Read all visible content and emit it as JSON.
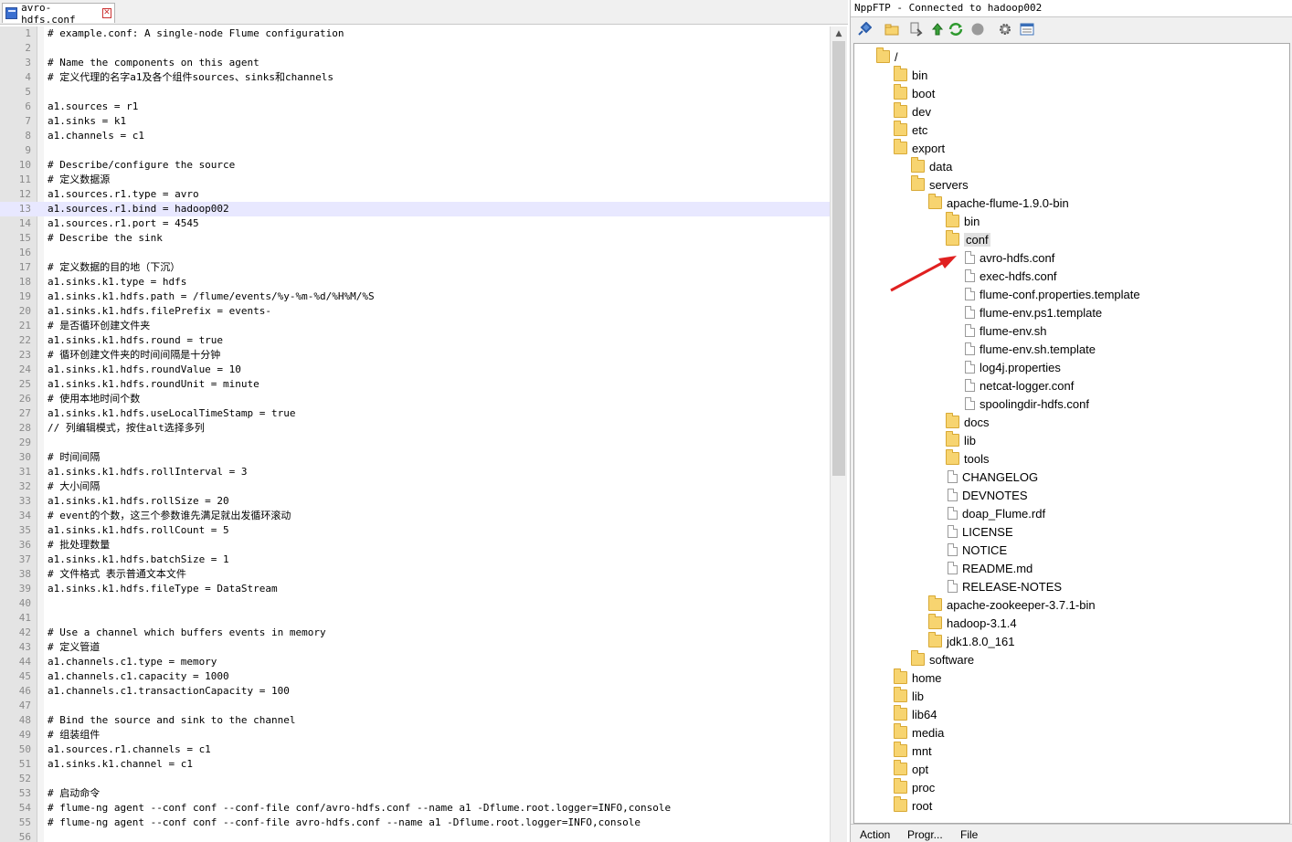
{
  "editor": {
    "tab_label": "avro-hdfs.conf",
    "current_line": 13,
    "lines": [
      "# example.conf: A single-node Flume configuration",
      "",
      "# Name the components on this agent",
      "# 定义代理的名字a1及各个组件sources、sinks和channels",
      "",
      "a1.sources = r1",
      "a1.sinks = k1",
      "a1.channels = c1",
      "",
      "# Describe/configure the source",
      "# 定义数据源",
      "a1.sources.r1.type = avro",
      "a1.sources.r1.bind = hadoop002",
      "a1.sources.r1.port = 4545",
      "# Describe the sink",
      "",
      "# 定义数据的目的地（下沉）",
      "a1.sinks.k1.type = hdfs",
      "a1.sinks.k1.hdfs.path = /flume/events/%y-%m-%d/%H%M/%S",
      "a1.sinks.k1.hdfs.filePrefix = events-",
      "# 是否循环创建文件夹",
      "a1.sinks.k1.hdfs.round = true",
      "# 循环创建文件夹的时间间隔是十分钟",
      "a1.sinks.k1.hdfs.roundValue = 10",
      "a1.sinks.k1.hdfs.roundUnit = minute",
      "# 使用本地时间个数",
      "a1.sinks.k1.hdfs.useLocalTimeStamp = true",
      "// 列编辑模式，按住alt选择多列",
      "",
      "# 时间间隔",
      "a1.sinks.k1.hdfs.rollInterval = 3",
      "# 大小间隔",
      "a1.sinks.k1.hdfs.rollSize = 20",
      "# event的个数，这三个参数谁先满足就出发循环滚动",
      "a1.sinks.k1.hdfs.rollCount = 5",
      "# 批处理数量",
      "a1.sinks.k1.hdfs.batchSize = 1",
      "# 文件格式 表示普通文本文件",
      "a1.sinks.k1.hdfs.fileType = DataStream",
      "",
      "",
      "# Use a channel which buffers events in memory",
      "# 定义管道",
      "a1.channels.c1.type = memory",
      "a1.channels.c1.capacity = 1000",
      "a1.channels.c1.transactionCapacity = 100",
      "",
      "# Bind the source and sink to the channel",
      "# 组装组件",
      "a1.sources.r1.channels = c1",
      "a1.sinks.k1.channel = c1",
      "",
      "# 启动命令",
      "# flume-ng agent --conf conf --conf-file conf/avro-hdfs.conf --name a1 -Dflume.root.logger=INFO,console",
      "# flume-ng agent --conf conf --conf-file avro-hdfs.conf --name a1 -Dflume.root.logger=INFO,console",
      ""
    ]
  },
  "ftp": {
    "title": "NppFTP - Connected to hadoop002",
    "toolbar_icons": [
      "connect-icon",
      "open-folder-icon",
      "download-icon",
      "upload-icon",
      "refresh-icon",
      "stop-icon",
      "settings-icon",
      "message-window-icon"
    ],
    "tree": [
      {
        "label": "/",
        "type": "folder",
        "depth": 0
      },
      {
        "label": "bin",
        "type": "folder",
        "depth": 1
      },
      {
        "label": "boot",
        "type": "folder",
        "depth": 1
      },
      {
        "label": "dev",
        "type": "folder",
        "depth": 1
      },
      {
        "label": "etc",
        "type": "folder",
        "depth": 1
      },
      {
        "label": "export",
        "type": "folder",
        "depth": 1
      },
      {
        "label": "data",
        "type": "folder",
        "depth": 2
      },
      {
        "label": "servers",
        "type": "folder",
        "depth": 2
      },
      {
        "label": "apache-flume-1.9.0-bin",
        "type": "folder",
        "depth": 3
      },
      {
        "label": "bin",
        "type": "folder",
        "depth": 4
      },
      {
        "label": "conf",
        "type": "folder",
        "depth": 4,
        "selected": true
      },
      {
        "label": "avro-hdfs.conf",
        "type": "file",
        "depth": 5
      },
      {
        "label": "exec-hdfs.conf",
        "type": "file",
        "depth": 5
      },
      {
        "label": "flume-conf.properties.template",
        "type": "file",
        "depth": 5
      },
      {
        "label": "flume-env.ps1.template",
        "type": "file",
        "depth": 5
      },
      {
        "label": "flume-env.sh",
        "type": "file",
        "depth": 5
      },
      {
        "label": "flume-env.sh.template",
        "type": "file",
        "depth": 5
      },
      {
        "label": "log4j.properties",
        "type": "file",
        "depth": 5
      },
      {
        "label": "netcat-logger.conf",
        "type": "file",
        "depth": 5
      },
      {
        "label": "spoolingdir-hdfs.conf",
        "type": "file",
        "depth": 5
      },
      {
        "label": "docs",
        "type": "folder",
        "depth": 4
      },
      {
        "label": "lib",
        "type": "folder",
        "depth": 4
      },
      {
        "label": "tools",
        "type": "folder",
        "depth": 4
      },
      {
        "label": "CHANGELOG",
        "type": "file",
        "depth": 4
      },
      {
        "label": "DEVNOTES",
        "type": "file",
        "depth": 4
      },
      {
        "label": "doap_Flume.rdf",
        "type": "file",
        "depth": 4
      },
      {
        "label": "LICENSE",
        "type": "file",
        "depth": 4
      },
      {
        "label": "NOTICE",
        "type": "file",
        "depth": 4
      },
      {
        "label": "README.md",
        "type": "file",
        "depth": 4
      },
      {
        "label": "RELEASE-NOTES",
        "type": "file",
        "depth": 4
      },
      {
        "label": "apache-zookeeper-3.7.1-bin",
        "type": "folder",
        "depth": 3
      },
      {
        "label": "hadoop-3.1.4",
        "type": "folder",
        "depth": 3
      },
      {
        "label": "jdk1.8.0_161",
        "type": "folder",
        "depth": 3
      },
      {
        "label": "software",
        "type": "folder",
        "depth": 2
      },
      {
        "label": "home",
        "type": "folder",
        "depth": 1
      },
      {
        "label": "lib",
        "type": "folder",
        "depth": 1
      },
      {
        "label": "lib64",
        "type": "folder",
        "depth": 1
      },
      {
        "label": "media",
        "type": "folder",
        "depth": 1
      },
      {
        "label": "mnt",
        "type": "folder",
        "depth": 1
      },
      {
        "label": "opt",
        "type": "folder",
        "depth": 1
      },
      {
        "label": "proc",
        "type": "folder",
        "depth": 1
      },
      {
        "label": "root",
        "type": "folder",
        "depth": 1
      }
    ],
    "bottom_tabs": [
      "Action",
      "Progr...",
      "File"
    ],
    "colors": {
      "folder": "#f7d470",
      "arrow": "#e02020"
    }
  }
}
